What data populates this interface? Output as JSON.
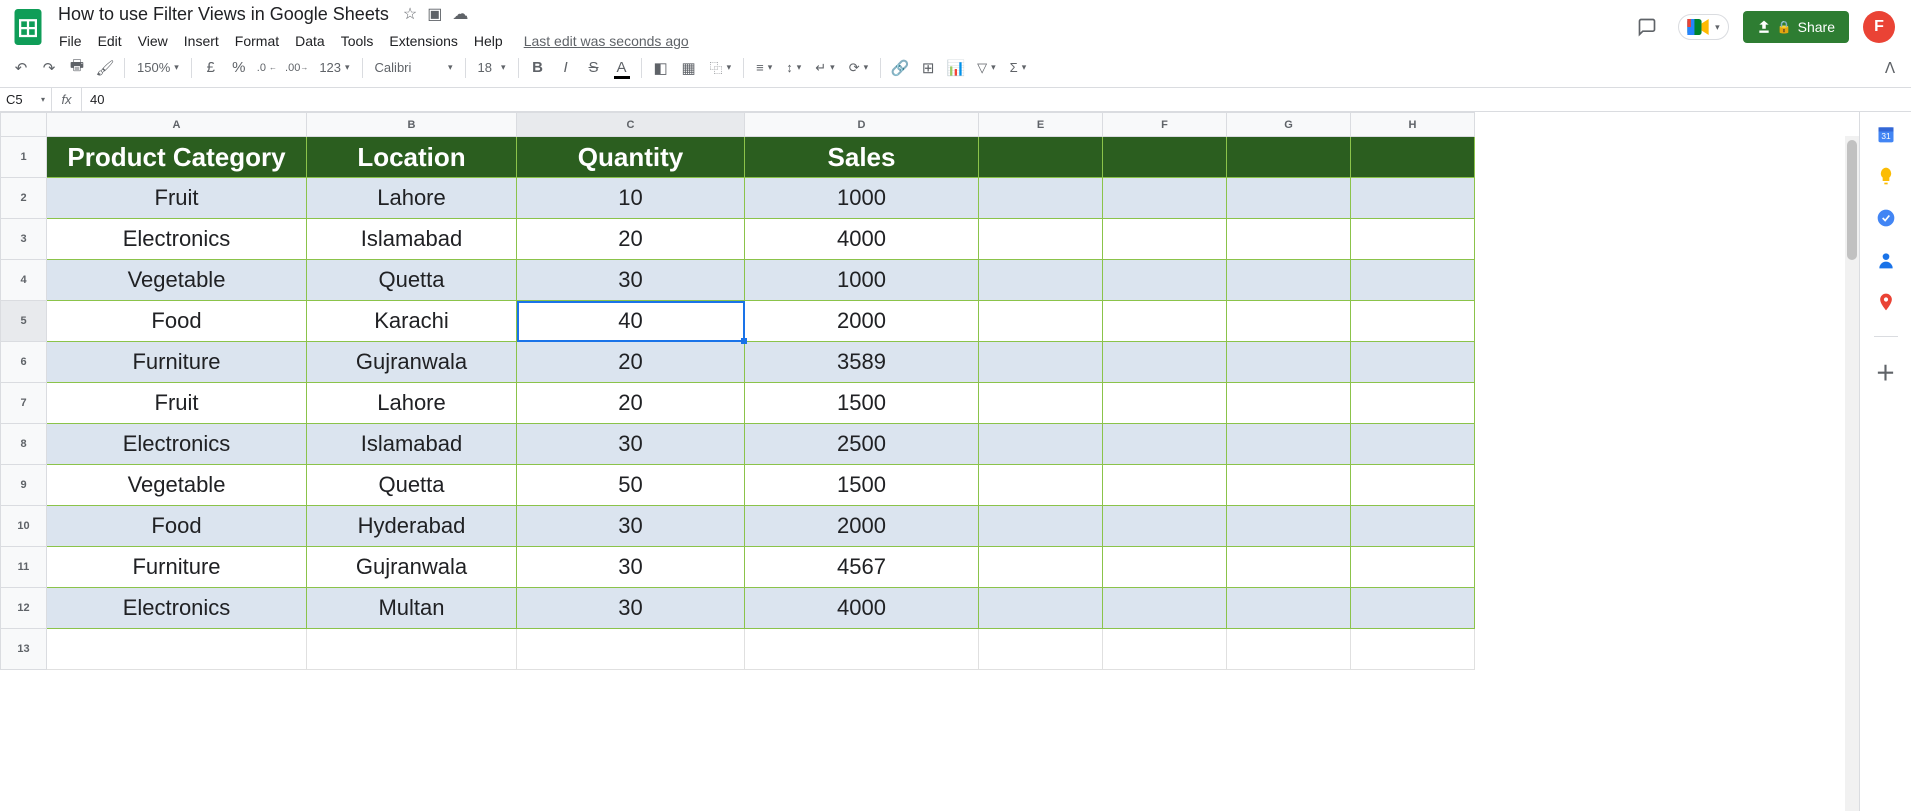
{
  "doc": {
    "title": "How to use Filter Views in Google Sheets",
    "last_edit": "Last edit was seconds ago"
  },
  "menus": [
    "File",
    "Edit",
    "View",
    "Insert",
    "Format",
    "Data",
    "Tools",
    "Extensions",
    "Help"
  ],
  "toolbar": {
    "zoom": "150%",
    "currency": "£",
    "percent": "%",
    "dec_dec": ".0",
    "inc_dec": ".00",
    "numfmt": "123",
    "font": "Calibri",
    "size": "18"
  },
  "share_label": "Share",
  "namebox": "C5",
  "fx_label": "fx",
  "formula": "40",
  "columns": [
    "A",
    "B",
    "C",
    "D",
    "E",
    "F",
    "G",
    "H"
  ],
  "row_count": 13,
  "selected": {
    "row": 5,
    "col": "C"
  },
  "chart_data": {
    "type": "table",
    "headers": [
      "Product Category",
      "Location",
      "Quantity",
      "Sales"
    ],
    "rows": [
      [
        "Fruit",
        "Lahore",
        "10",
        "1000"
      ],
      [
        "Electronics",
        "Islamabad",
        "20",
        "4000"
      ],
      [
        "Vegetable",
        "Quetta",
        "30",
        "1000"
      ],
      [
        "Food",
        "Karachi",
        "40",
        "2000"
      ],
      [
        "Furniture",
        "Gujranwala",
        "20",
        "3589"
      ],
      [
        "Fruit",
        "Lahore",
        "20",
        "1500"
      ],
      [
        "Electronics",
        "Islamabad",
        "30",
        "2500"
      ],
      [
        "Vegetable",
        "Quetta",
        "50",
        "1500"
      ],
      [
        "Food",
        "Hyderabad",
        "30",
        "2000"
      ],
      [
        "Furniture",
        "Gujranwala",
        "30",
        "4567"
      ],
      [
        "Electronics",
        "Multan",
        "30",
        "4000"
      ]
    ]
  },
  "avatar_letter": "F"
}
